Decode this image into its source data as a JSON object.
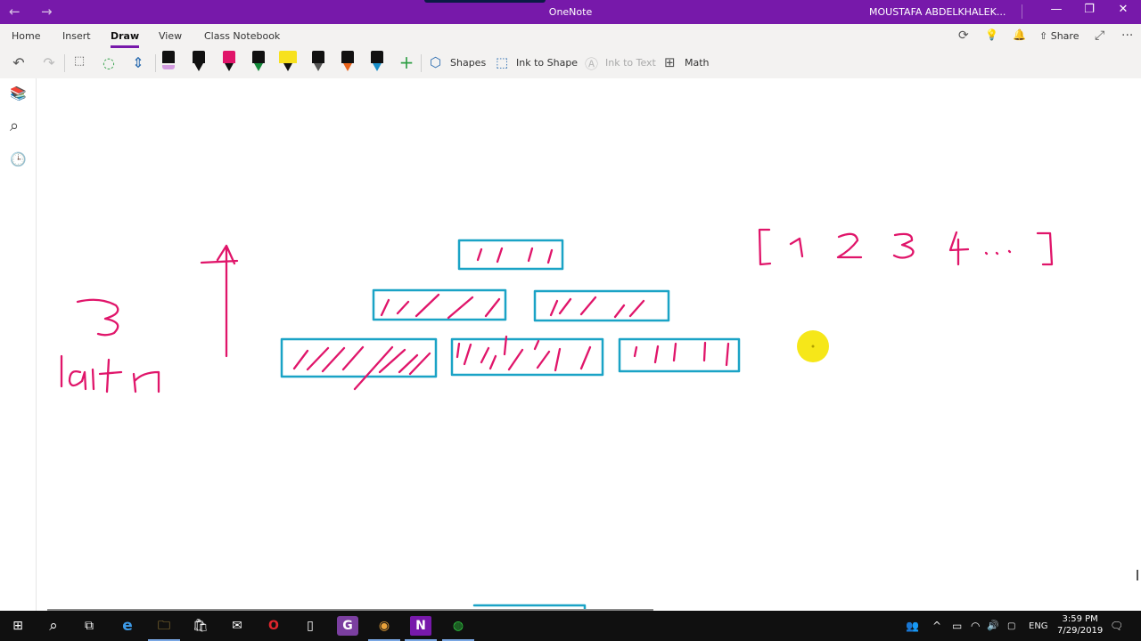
{
  "titlebar": {
    "back": "←",
    "forward": "→",
    "app_name": "OneNote",
    "user": "MOUSTAFA ABDELKHALEK...",
    "minimize": "—",
    "restore": "❐",
    "close": "✕"
  },
  "tabs": [
    "Home",
    "Insert",
    "Draw",
    "View",
    "Class Notebook"
  ],
  "active_tab": "Draw",
  "top_icons": {
    "sync": "⟳",
    "lightbulb": "💡",
    "bell": "🔔",
    "share": "Share",
    "expand": "⤢",
    "more": "···"
  },
  "toolbar": {
    "undo": "↶",
    "redo": "↷",
    "lasso": "⬚",
    "select": "◌",
    "space": "⇕",
    "add_pen": "+",
    "shapes": "Shapes",
    "ink_to_shape": "Ink to Shape",
    "ink_to_text": "Ink to Text",
    "math": "Math"
  },
  "pens": [
    {
      "band": "#d39be0"
    },
    {
      "band": "#000000"
    },
    {
      "band": "#e0156a"
    },
    {
      "band": "#138a3a"
    },
    {
      "band": "#f7e11e"
    },
    {
      "band": "#ffffff"
    },
    {
      "band": "#e8631b"
    },
    {
      "band": "#1a8fc9"
    }
  ],
  "leftrail": {
    "notebooks": "📚",
    "search": "⌕",
    "recent": "🕒"
  },
  "canvas_ink": {
    "ink_pink": "#e0156a",
    "ink_blue": "#1aa3c6",
    "cursor_color": "#f5e400",
    "handwritten_number": "3",
    "handwritten_word": "laitr",
    "array_text": [
      "1",
      "2",
      "3",
      "4",
      "..."
    ]
  },
  "taskbar": {
    "icons": [
      "start-icon",
      "search-icon",
      "task-view-icon",
      "edge-icon",
      "file-explorer-icon",
      "store-icon",
      "mail-icon",
      "opera-icon",
      "file-icon",
      "pdf-app-icon",
      "chrome-icon",
      "onenote-icon",
      "app-icon"
    ],
    "glyphs": {
      "start": "⊞",
      "search": "⌕",
      "task_view": "⧉",
      "edge": "e",
      "folder": "🗀",
      "store": "🛍",
      "mail": "✉",
      "opera": "O",
      "file": "▯",
      "pdf": "G",
      "chrome": "◉",
      "onenote": "N",
      "app": "◍"
    },
    "tray": {
      "people": "👥",
      "chevron": "^",
      "battery": "▭",
      "wifi": "◠",
      "volume": "🔊",
      "lang": "ENG",
      "notifications": "🗨"
    },
    "time": "3:59 PM",
    "date": "7/29/2019"
  }
}
